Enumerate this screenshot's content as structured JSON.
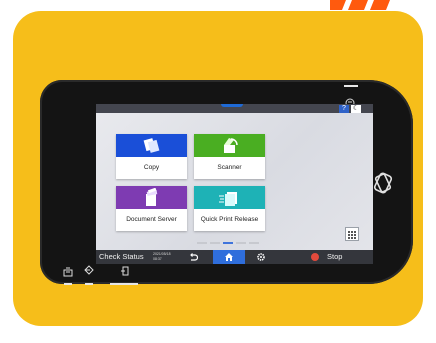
{
  "colors": {
    "background_card": "#f6be1a",
    "device_body": "#141414",
    "copy_tile": "#1a4fd8",
    "scanner_tile": "#4aae22",
    "document_server_tile": "#7e3bb2",
    "quick_print_tile": "#1eb2b6",
    "home_active": "#2f6edc",
    "stop_red": "#e24a3c"
  },
  "header": {
    "help_label": "?",
    "moon_label": "☾"
  },
  "apps": [
    {
      "label": "Copy",
      "icon": "copy-icon"
    },
    {
      "label": "Scanner",
      "icon": "scanner-icon"
    },
    {
      "label": "Document Server",
      "icon": "document-server-icon"
    },
    {
      "label": "Quick Print Release",
      "icon": "quick-print-release-icon"
    }
  ],
  "pager": {
    "pages": 5,
    "active_index": 2
  },
  "bottom_bar": {
    "check_status": "Check Status",
    "date": "2021/05/18",
    "time": "08:37",
    "stop": "Stop"
  },
  "icons": {
    "back": "back-icon",
    "home": "home-icon",
    "settings": "gear-icon",
    "grid": "grid-icon",
    "nfc": "nfc-icon"
  }
}
